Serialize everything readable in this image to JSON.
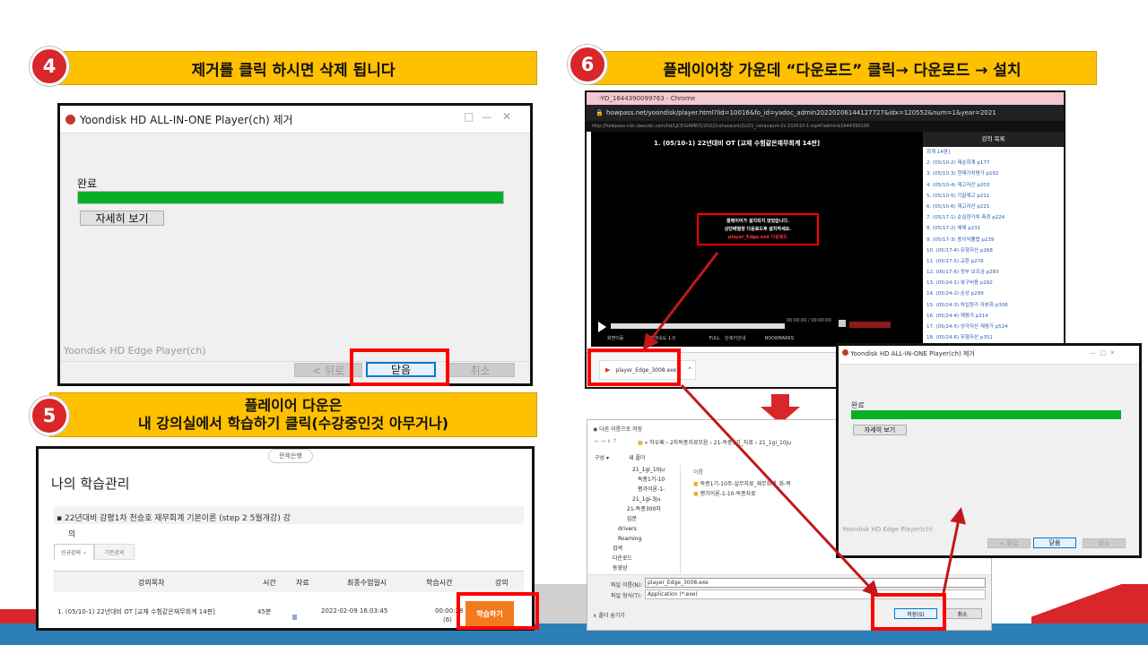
{
  "steps": {
    "s4": {
      "number": "4",
      "text": "제거를 클릭 하시면 삭제 됩니다"
    },
    "s5": {
      "number": "5",
      "line1": "플레이어 다운은",
      "line2": "내 강의실에서 학습하기 클릭(수강중인것 아무거나)"
    },
    "s6": {
      "number": "6",
      "text": "플레이어창 가운데 “다운로드” 클릭→ 다운로드 → 설치"
    }
  },
  "uninstall_dialog": {
    "title": "Yoondisk HD ALL-IN-ONE Player(ch) 제거",
    "status": "완료",
    "progress": 1.0,
    "details_button": "자세히 보기",
    "footer_brand": "Yoondisk HD Edge Player(ch)",
    "back_button": "< 뒤로",
    "close_button": "닫음",
    "cancel_button": "취소",
    "minimize": "—",
    "maximize": "□",
    "close_x": "✕"
  },
  "learning": {
    "top_tab": "문제은행",
    "title": "나의 학습관리",
    "course_line1": "22년대비 감평1차 천승호 재무회계 기본이론 (step 2 5월개강) 강",
    "course_line2": "의",
    "tab_active": "신규강의",
    "tab_other": "기존강의",
    "headers": [
      "강의목차",
      "시간",
      "자료",
      "최종수업일시",
      "학습시간",
      "강의"
    ],
    "row": {
      "title": "1. (05/10-1) 22년대비 OT [교재 수험같은재무회계 14판]",
      "time": "45분",
      "last_date": "2022-02-09 16:03:45",
      "study_time": "00:00:28",
      "study_count": "(6)",
      "action": "학습하기"
    }
  },
  "chrome": {
    "title": "-YD_1644390099763 - Chrome",
    "url": "howpass.net/yoondisk/player.html?lid=10016&fo_id=yadoc_admin20220206144127727&idx=120552&num=1&year=2021",
    "sub_url": "http://howpass-cdn.dasuidc.com/hd/LJCE/GAMP/1/2022/cshacaunt/2c/21_cshacaunt-2c-210510-1.mp4?admin&1644390100",
    "video_title": "1. (05/10-1) 22년대비 OT [교재 수험같은재무회계 14판]",
    "sidebar_title": "강의 목록",
    "sidebar_items": [
      "회계 14판]",
      "2. (05/10-2) 재순회계 p177",
      "3. (05/10-3) 현재가치평가 p182",
      "4. (05/10-4) 재고자산 p203",
      "5. (05/10-5) 기말재고 p211",
      "6. (05/10-6) 재고자산 p221",
      "7. (05/17-1) 순실현가치 측정 p224",
      "8. (05/17-2) 예제 p231",
      "9. (05/17-3) 종이익률법 p239",
      "10. (05/17-4) 유형자산 p268",
      "11. (05/17-5) 교환 p276",
      "12. (05/17-6) 정부 보조금 p283",
      "13. (05/24-1) 복구비용 p292",
      "14. (05/24-2) 손상 p299",
      "15. (05/24-3) 차입원가 자본화 p306",
      "16. (05/24-4) 재평가 p314",
      "17. (05/24-5) 상각자산 재평가 p524",
      "18. (05/24-6) 무형자산 p351"
    ],
    "alert_line1": "플레이어가 설치되지 않았습니다.",
    "alert_line2": "상단배열창 다운로드후 설치하세요.",
    "alert_link": "player_Edge.exe 다운로드",
    "time_display": "00:00:00 / 00:00:00",
    "controls_left": "화면이동",
    "speed_label": "재생속도",
    "speed_value": "1.0",
    "full_label": "FULL",
    "shortcut_label": "단축키안내",
    "bookmarks_label": "BOOKMARKS",
    "download_file": "player_Edge_3008.exe"
  },
  "save_dialog": {
    "title": "다른 이름으로 저장",
    "path": [
      "하우패",
      "2차독종자료모음",
      "21-독종1기_자료",
      "21_1gi_10ju"
    ],
    "organize": "구성",
    "new_folder": "새 폴더",
    "tree": [
      "21_1gi_10ju",
      "독종1기-10",
      "평가이론-1-",
      "21_1gi-3ju",
      "21-독종300차",
      "입문",
      "drivers",
      "Roaming",
      "검색",
      "다운로드",
      "동영상"
    ],
    "column_name": "이름",
    "files": [
      "독종1기-10주-실무자료_재무회계_화-목",
      "평가이론-1-10-독종자료"
    ],
    "filename_label": "파일 이름(N):",
    "filename_value": "player_Edge_3008.exe",
    "filetype_label": "파일 형식(T):",
    "filetype_value": "Application (*.exe)",
    "hide_folders": "폴더 숨기기",
    "save_button": "저장(S)",
    "cancel_button": "취소"
  },
  "mini_uninstall": {
    "title": "Yoondisk HD ALL-IN-ONE Player(ch) 제거",
    "status": "완료",
    "details_button": "자세히 보기",
    "footer_brand": "Yoondisk HD Edge Player(ch)",
    "back_button": "< 뒤로",
    "close_button": "닫음",
    "cancel_button": "취소"
  }
}
